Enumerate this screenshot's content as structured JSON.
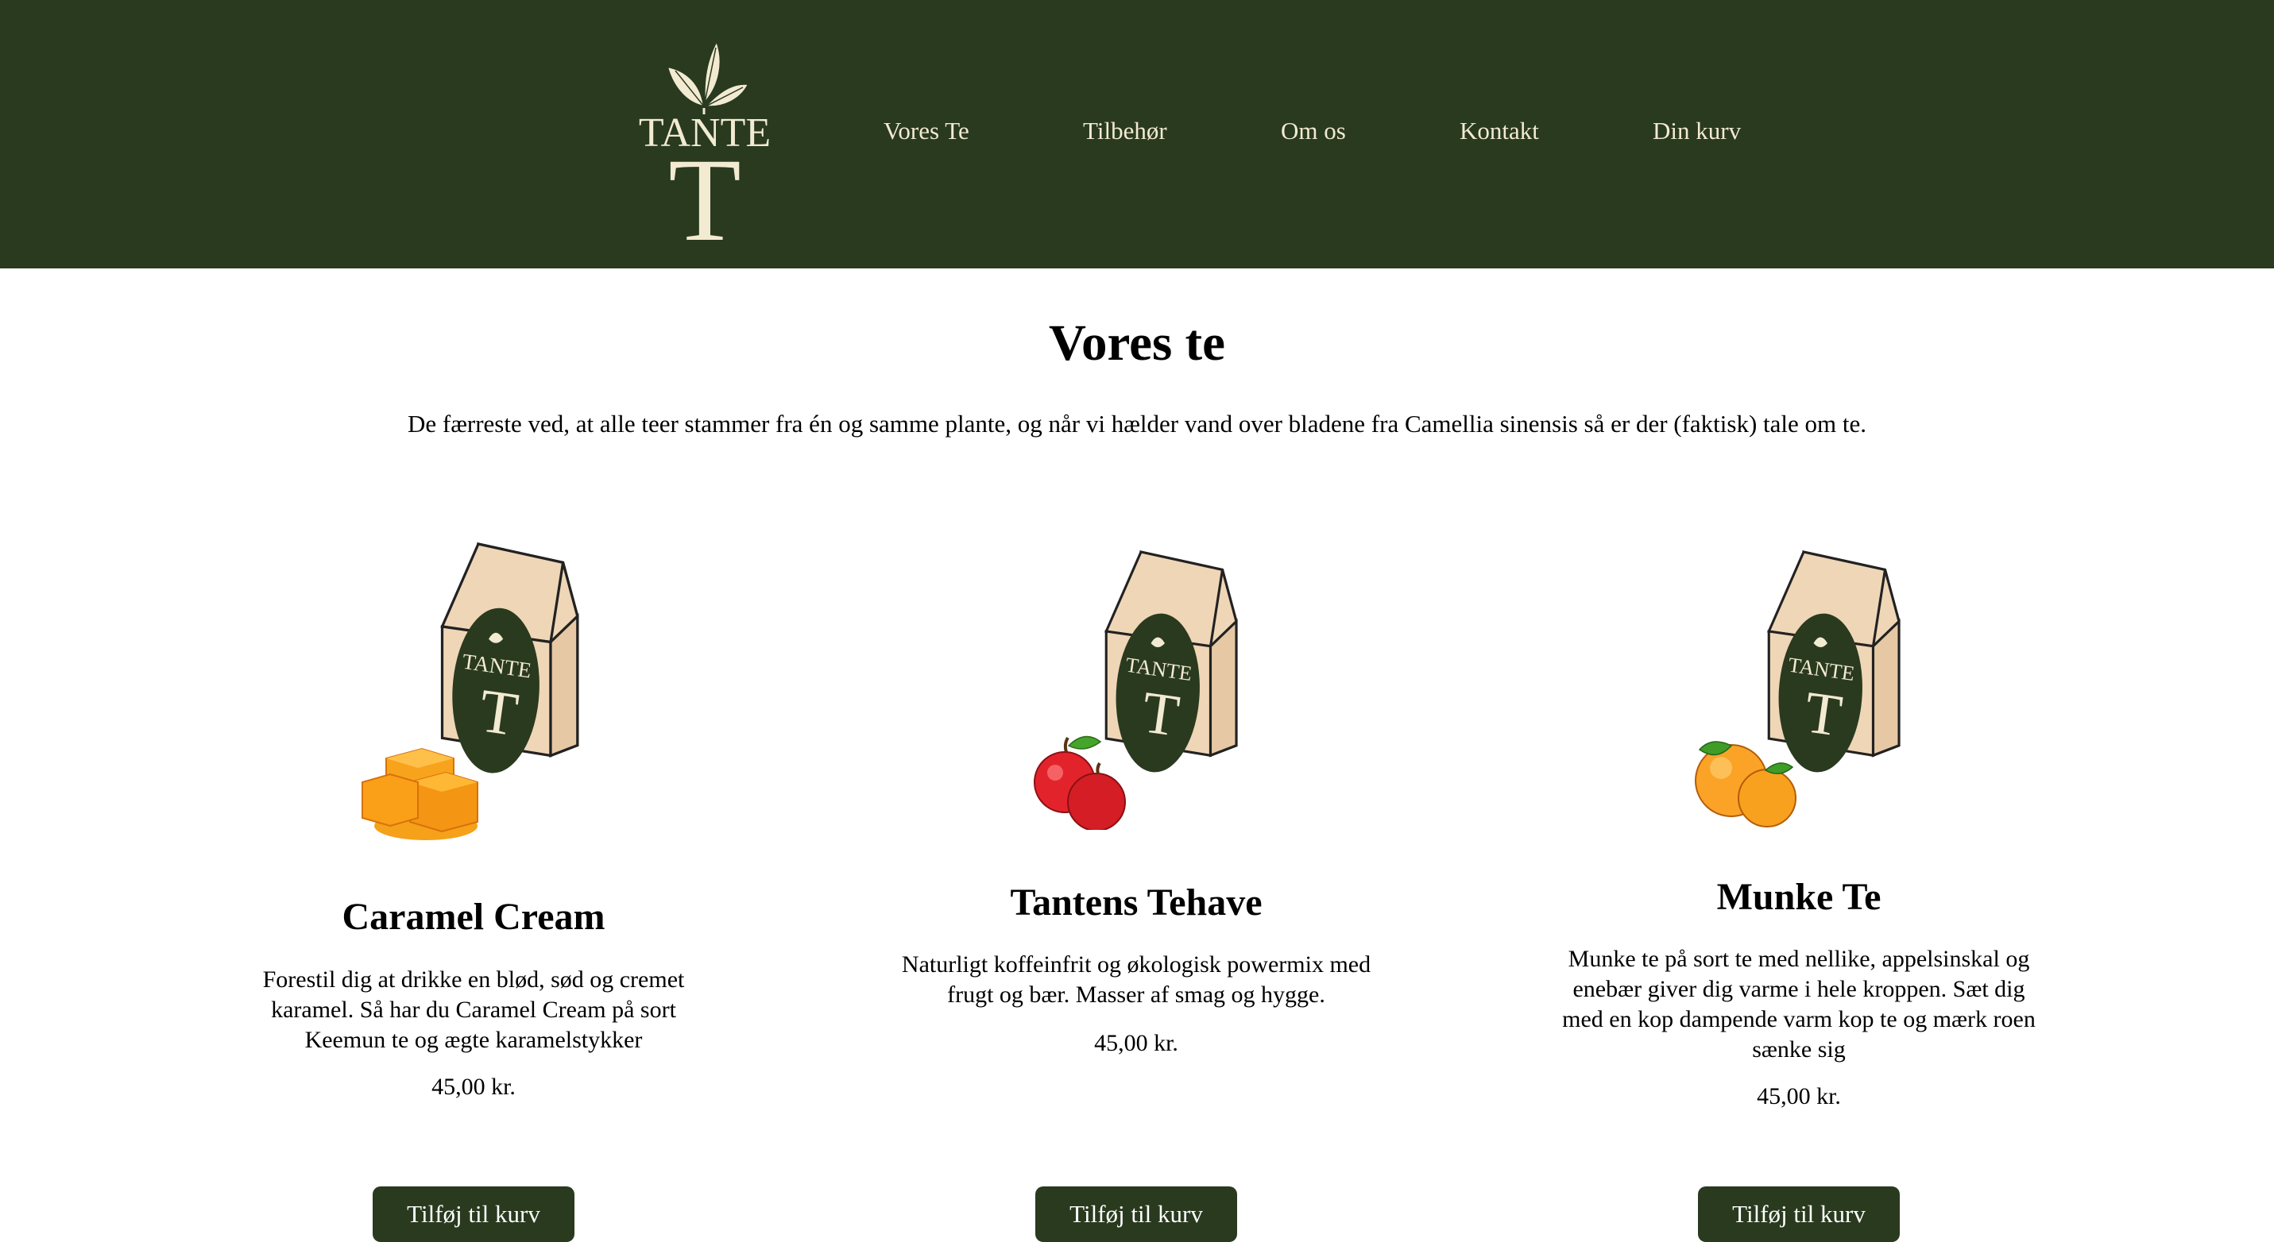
{
  "header": {
    "brand": {
      "line1": "TANTE",
      "line2": "T"
    },
    "nav": [
      "Vores Te",
      "Tilbehør",
      "Om os",
      "Kontakt",
      "Din kurv"
    ]
  },
  "main": {
    "title": "Vores te",
    "intro": "De færreste ved, at alle teer stammer fra én og samme plante, og når vi hælder vand over bladene fra Camellia sinensis så er der (faktisk) tale om te."
  },
  "products": [
    {
      "name": "Caramel Cream",
      "desc_lines": [
        "Forestil dig at drikke en blød, sød og cremet",
        "karamel. Så har du Caramel Cream på sort",
        "Keemun te og ægte karamelstykker"
      ],
      "price": "45,00 kr.",
      "button": "Tilføj til kurv",
      "image": "tea-bag-with-caramel"
    },
    {
      "name": "Tantens Tehave",
      "desc_lines": [
        "Naturligt koffeinfrit og økologisk powermix med",
        "frugt og bær. Masser af smag og hygge."
      ],
      "price": "45,00 kr.",
      "button": "Tilføj til kurv",
      "image": "tea-bag-with-apples"
    },
    {
      "name": "Munke Te",
      "desc_lines": [
        "Munke te på sort te med nellike, appelsinskal og",
        "enebær giver dig varme i hele kroppen. Sæt dig",
        "med en kop dampende varm kop te og mærk roen",
        "sænke sig"
      ],
      "price": "45,00 kr.",
      "button": "Tilføj til kurv",
      "image": "tea-bag-with-oranges"
    }
  ],
  "colors": {
    "header_bg": "#293a1f",
    "cream": "#f2ead1",
    "bag": "#eed4b4",
    "button_bg": "#293a1f"
  }
}
